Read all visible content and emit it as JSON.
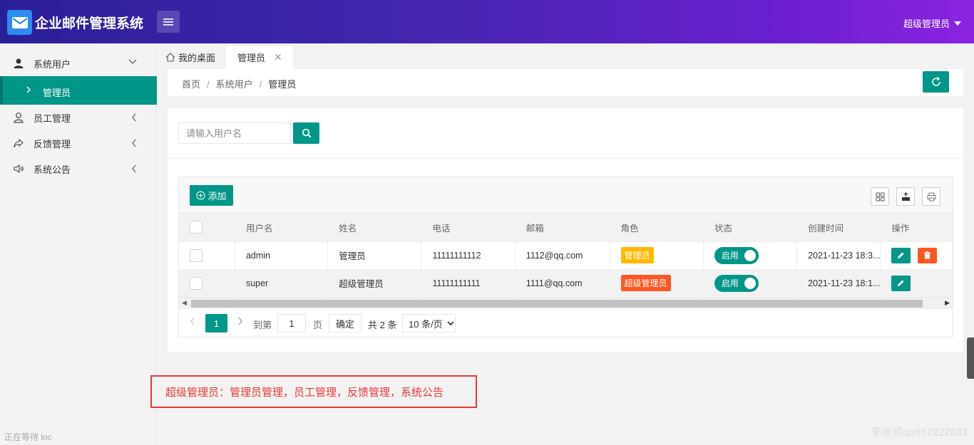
{
  "header": {
    "app_title": "企业邮件管理系统",
    "user_label": "超级管理员",
    "logo_icon": "envelope-icon",
    "menu_icon": "hamburger-icon",
    "gradient": [
      "#2b1f99",
      "#8b23e0"
    ]
  },
  "sidebar": {
    "items": [
      {
        "label": "系统用户",
        "icon": "user-icon",
        "expanded": true
      },
      {
        "label": "管理员",
        "active": true
      },
      {
        "label": "员工管理",
        "icon": "user-outline-icon"
      },
      {
        "label": "反馈管理",
        "icon": "share-icon"
      },
      {
        "label": "系统公告",
        "icon": "speaker-icon"
      }
    ],
    "status_text": "正在等待 loc",
    "active_color": "#009688"
  },
  "tabs": {
    "home": "我的桌面",
    "active": "管理员",
    "close_glyph": "✕"
  },
  "breadcrumb": {
    "items": [
      "首页",
      "系统用户"
    ],
    "current": "管理员",
    "separator": "/"
  },
  "search": {
    "placeholder": "请输入用户名",
    "value": ""
  },
  "toolbar": {
    "add_label": "添加"
  },
  "table": {
    "columns": [
      "用户名",
      "姓名",
      "电话",
      "邮箱",
      "角色",
      "状态",
      "创建时间",
      "操作"
    ],
    "rows": [
      {
        "username": "admin",
        "name": "管理员",
        "phone": "11111111112",
        "email": "1112@qq.com",
        "role": "管理员",
        "role_color": "#ffb800",
        "status": "启用",
        "created": "2021-11-23 18:3..."
      },
      {
        "username": "super",
        "name": "超级管理员",
        "phone": "11111111111",
        "email": "1111@qq.com",
        "role": "超级管理员",
        "role_color": "#ff5722",
        "status": "启用",
        "created": "2021-11-23 18:1..."
      }
    ]
  },
  "pager": {
    "current_page": "1",
    "goto_label": "到第",
    "goto_value": "1",
    "page_label": "页",
    "confirm_label": "确定",
    "total_label": "共 2 条",
    "page_size": "10 条/页"
  },
  "notice": "超级管理员：管理员管理，员工管理，反馈管理，系统公告",
  "watermark": "李老师qq857222631"
}
